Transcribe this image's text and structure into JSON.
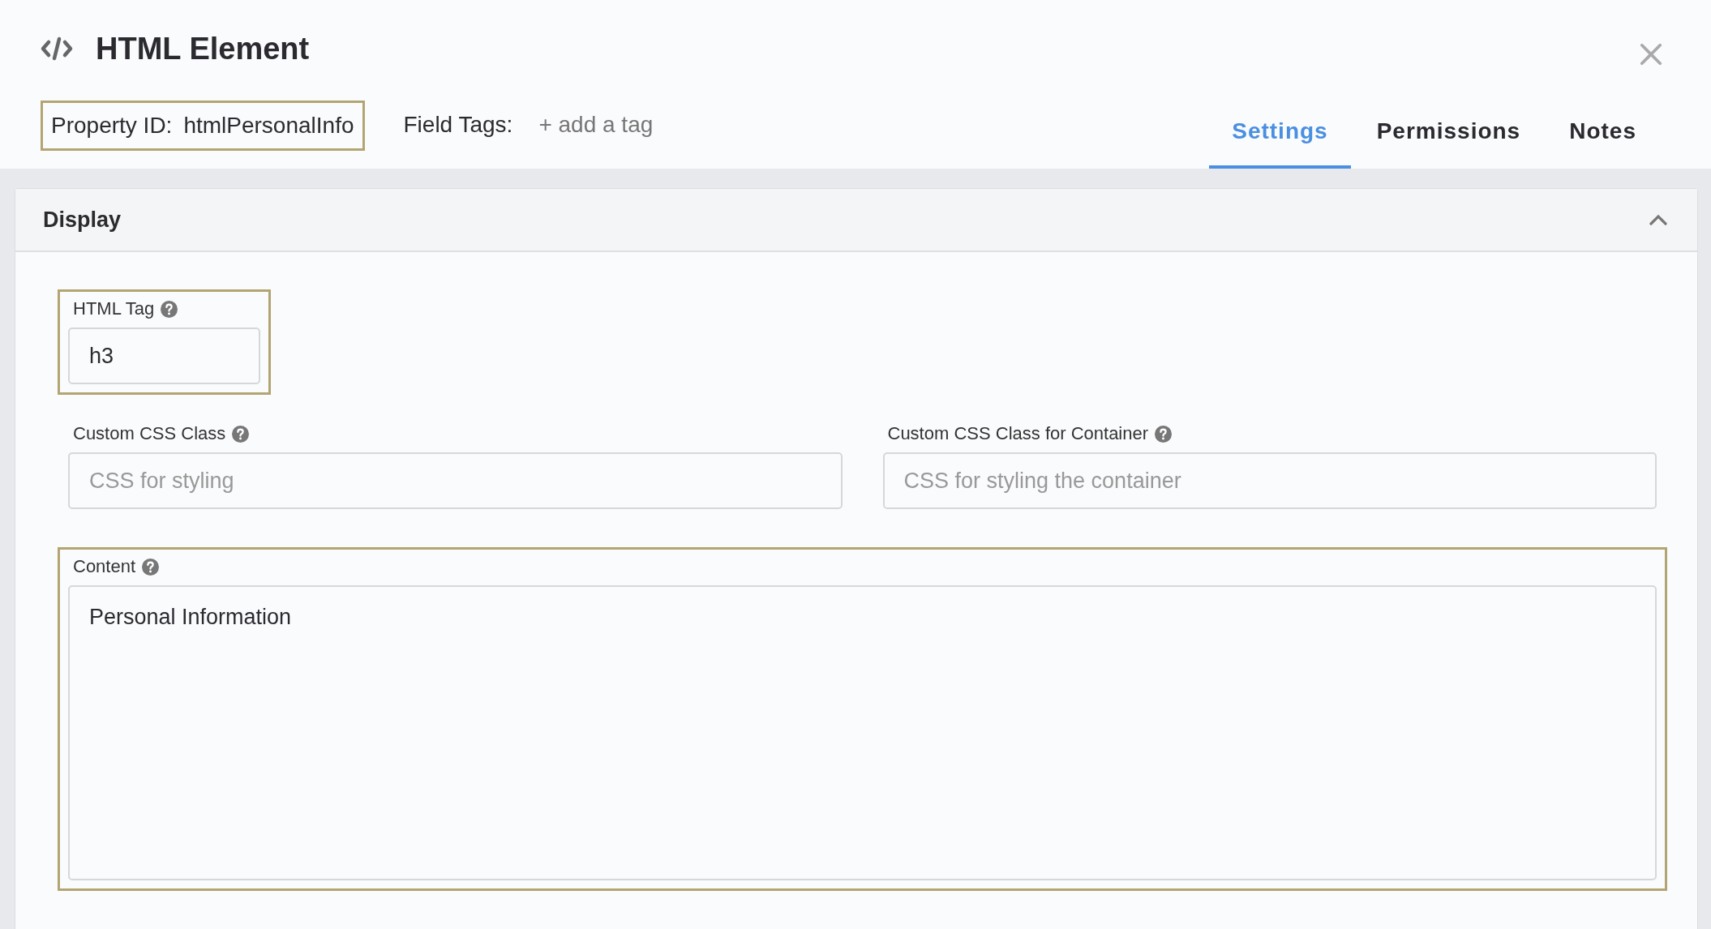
{
  "header": {
    "title": "HTML Element",
    "property_id": {
      "label": "Property ID:",
      "value": "htmlPersonalInfo",
      "highlighted": true
    },
    "field_tags": {
      "label": "Field Tags:",
      "action": "+ add a tag"
    }
  },
  "tabs": [
    {
      "label": "Settings",
      "selected": true
    },
    {
      "label": "Permissions",
      "selected": false
    },
    {
      "label": "Notes",
      "selected": false
    }
  ],
  "section": {
    "title": "Display",
    "expanded": true,
    "rows": [
      {
        "fields": [
          {
            "kind": "short",
            "label": "HTML Tag",
            "value": "h3",
            "highlighted": true
          }
        ]
      },
      {
        "fields": [
          {
            "kind": "input",
            "label": "Custom CSS Class",
            "placeholder": "CSS for styling",
            "highlighted": false
          },
          {
            "kind": "input",
            "label": "Custom CSS Class for Container",
            "placeholder": "CSS for styling the container",
            "highlighted": false
          }
        ]
      },
      {
        "fields": [
          {
            "kind": "textarea",
            "label": "Content",
            "value": "Personal Information",
            "highlighted": true
          }
        ]
      }
    ]
  }
}
